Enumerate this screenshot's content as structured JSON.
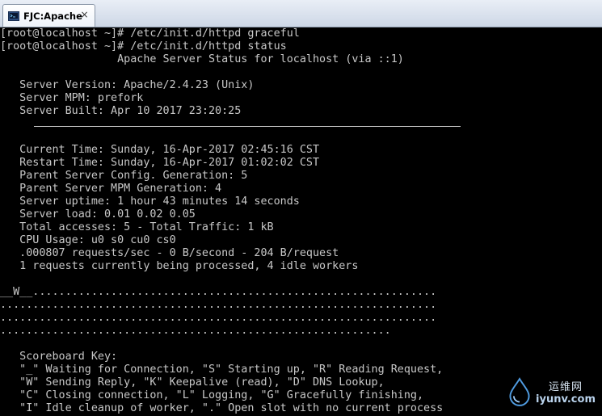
{
  "window": {
    "tab_title": "FJC:Apache",
    "close_glyph": "×"
  },
  "terminal": {
    "lines": [
      "[root@localhost ~]# /etc/init.d/httpd graceful",
      "[root@localhost ~]# /etc/init.d/httpd status",
      "                  Apache Server Status for localhost (via ::1)",
      "",
      "   Server Version: Apache/2.4.23 (Unix)",
      "   Server MPM: prefork",
      "   Server Built: Apr 10 2017 23:20:25",
      "__HR__",
      "",
      "   Current Time: Sunday, 16-Apr-2017 02:45:16 CST",
      "   Restart Time: Sunday, 16-Apr-2017 01:02:02 CST",
      "   Parent Server Config. Generation: 5",
      "   Parent Server MPM Generation: 4",
      "   Server uptime: 1 hour 43 minutes 14 seconds",
      "   Server load: 0.01 0.02 0.05",
      "   Total accesses: 5 - Total Traffic: 1 kB",
      "   CPU Usage: u0 s0 cu0 cs0",
      "   .000807 requests/sec - 0 B/second - 204 B/request",
      "   1 requests currently being processed, 4 idle workers",
      "",
      "__W__..............................................................",
      "...................................................................",
      "...................................................................",
      "............................................................",
      "",
      "   Scoreboard Key:",
      "   \"_\" Waiting for Connection, \"S\" Starting up, \"R\" Reading Request,",
      "   \"W\" Sending Reply, \"K\" Keepalive (read), \"D\" DNS Lookup,",
      "   \"C\" Closing connection, \"L\" Logging, \"G\" Gracefully finishing,",
      "   \"I\" Idle cleanup of worker, \".\" Open slot with no current process"
    ]
  },
  "watermark": {
    "cn": "运维网",
    "en": "iyunv.com",
    "icon": "droplet-logo-icon"
  },
  "colors": {
    "terminal_bg": "#000000",
    "terminal_fg": "#c8c8c8",
    "tabbar_bg": "#dce4f0"
  }
}
